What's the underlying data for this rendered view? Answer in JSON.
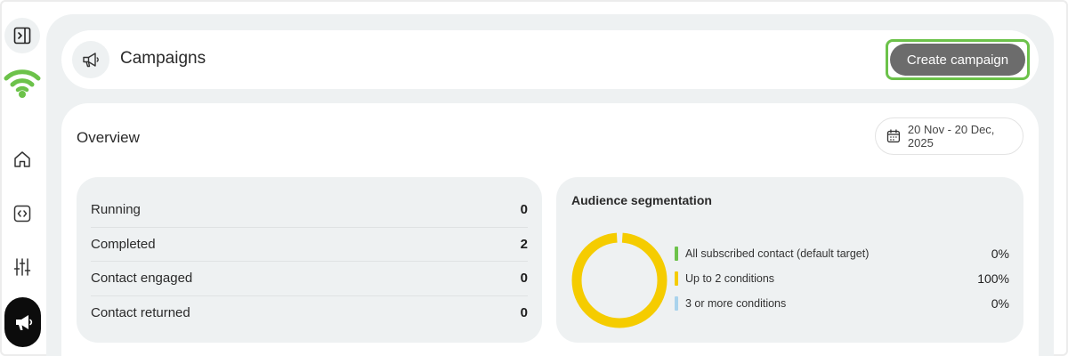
{
  "sidebar": {
    "items": [
      {
        "icon": "panel-toggle-icon",
        "active": false
      },
      {
        "icon": "wifi-logo-icon",
        "active": false
      },
      {
        "icon": "home-icon",
        "active": false
      },
      {
        "icon": "code-icon",
        "active": false
      },
      {
        "icon": "sliders-icon",
        "active": false
      },
      {
        "icon": "megaphone-icon",
        "active": true
      }
    ]
  },
  "header": {
    "title": "Campaigns",
    "create_button_label": "Create campaign"
  },
  "overview": {
    "title": "Overview",
    "date_range": "20 Nov - 20 Dec, 2025"
  },
  "stats": [
    {
      "label": "Running",
      "value": "0"
    },
    {
      "label": "Completed",
      "value": "2"
    },
    {
      "label": "Contact engaged",
      "value": "0"
    },
    {
      "label": "Contact returned",
      "value": "0"
    }
  ],
  "audience": {
    "title": "Audience segmentation",
    "segments": [
      {
        "label": "All subscribed contact (default target)",
        "value": "0%",
        "share": 0,
        "color": "#6cc24a"
      },
      {
        "label": "Up to 2 conditions",
        "value": "100%",
        "share": 100,
        "color": "#f5cc00"
      },
      {
        "label": "3 or more conditions",
        "value": "0%",
        "share": 0,
        "color": "#a9d3ec"
      }
    ]
  },
  "colors": {
    "brand_green": "#6cc24a",
    "highlight_outline": "#6cc24a",
    "cta_background": "#6c6c6c",
    "panel_background": "#eef1f2"
  }
}
